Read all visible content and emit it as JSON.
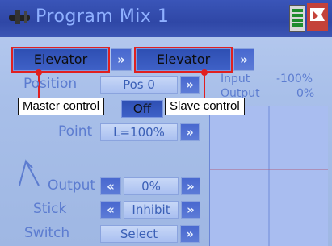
{
  "title_bar": {
    "title": "Program Mix 1"
  },
  "master": {
    "value": "Elevator"
  },
  "slave": {
    "value": "Elevator"
  },
  "position": {
    "label": "Position",
    "value": "Pos 0"
  },
  "readout": {
    "input_label": "Input",
    "input_value": "-100%",
    "output_label": "Output",
    "output_value": "0%"
  },
  "offset": {
    "value": "Off"
  },
  "point": {
    "label": "Point",
    "value": "L=100%"
  },
  "output": {
    "label": "Output",
    "value": "0%"
  },
  "stick": {
    "label": "Stick",
    "value": "Inhibit"
  },
  "switch": {
    "label": "Switch",
    "value": "Select"
  },
  "annotations": {
    "master": "Master control",
    "slave": "Slave control"
  },
  "arrows": {
    "next": "»",
    "prev": "«"
  },
  "colors": {
    "annotation_box": "#e02020",
    "label_text": "#5c7cd0",
    "title_bar": "#2f47a6"
  }
}
